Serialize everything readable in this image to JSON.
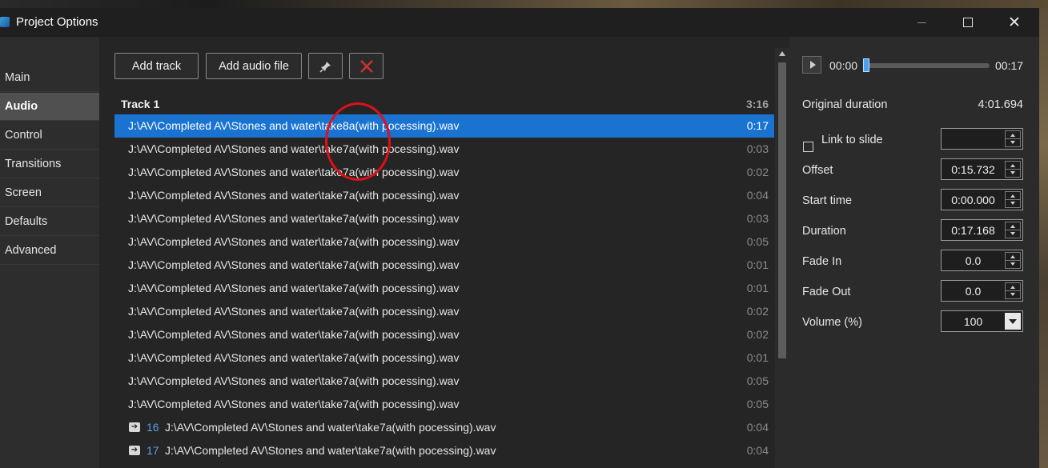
{
  "window": {
    "title": "Project Options",
    "controls": {
      "minimize": "—",
      "maximize": "☐",
      "close": "✕"
    }
  },
  "sidebar": {
    "items": [
      {
        "label": "Main",
        "active": false
      },
      {
        "label": "Audio",
        "active": true
      },
      {
        "label": "Control",
        "active": false
      },
      {
        "label": "Transitions",
        "active": false
      },
      {
        "label": "Screen",
        "active": false
      },
      {
        "label": "Defaults",
        "active": false
      },
      {
        "label": "Advanced",
        "active": false
      }
    ]
  },
  "toolbar": {
    "add_track_label": "Add track",
    "add_audio_file_label": "Add audio file",
    "edit_icon": "pin-icon",
    "delete_icon": "red-x-icon"
  },
  "track": {
    "name": "Track 1",
    "duration": "3:16",
    "files": [
      {
        "path": "J:\\AV\\Completed AV\\Stones and water\\take8a(with pocessing).wav",
        "time": "0:17",
        "selected": true
      },
      {
        "path": "J:\\AV\\Completed AV\\Stones and water\\take7a(with pocessing).wav",
        "time": "0:03"
      },
      {
        "path": "J:\\AV\\Completed AV\\Stones and water\\take7a(with pocessing).wav",
        "time": "0:02"
      },
      {
        "path": "J:\\AV\\Completed AV\\Stones and water\\take7a(with pocessing).wav",
        "time": "0:04"
      },
      {
        "path": "J:\\AV\\Completed AV\\Stones and water\\take7a(with pocessing).wav",
        "time": "0:03"
      },
      {
        "path": "J:\\AV\\Completed AV\\Stones and water\\take7a(with pocessing).wav",
        "time": "0:05"
      },
      {
        "path": "J:\\AV\\Completed AV\\Stones and water\\take7a(with pocessing).wav",
        "time": "0:01"
      },
      {
        "path": "J:\\AV\\Completed AV\\Stones and water\\take7a(with pocessing).wav",
        "time": "0:01"
      },
      {
        "path": "J:\\AV\\Completed AV\\Stones and water\\take7a(with pocessing).wav",
        "time": "0:02"
      },
      {
        "path": "J:\\AV\\Completed AV\\Stones and water\\take7a(with pocessing).wav",
        "time": "0:02"
      },
      {
        "path": "J:\\AV\\Completed AV\\Stones and water\\take7a(with pocessing).wav",
        "time": "0:01"
      },
      {
        "path": "J:\\AV\\Completed AV\\Stones and water\\take7a(with pocessing).wav",
        "time": "0:05"
      },
      {
        "path": "J:\\AV\\Completed AV\\Stones and water\\take7a(with pocessing).wav",
        "time": "0:05"
      },
      {
        "num": "16",
        "path": "J:\\AV\\Completed AV\\Stones and water\\take7a(with pocessing).wav",
        "time": "0:04",
        "linked": true
      },
      {
        "num": "17",
        "path": "J:\\AV\\Completed AV\\Stones and water\\take7a(with pocessing).wav",
        "time": "0:04",
        "linked": true
      }
    ]
  },
  "player": {
    "position": "00:00",
    "length": "00:17",
    "progress": 0
  },
  "properties": {
    "original_duration_label": "Original duration",
    "original_duration_value": "4:01.694",
    "link_to_slide_label": "Link to slide",
    "link_to_slide_checked": false,
    "link_to_slide_value": "",
    "offset_label": "Offset",
    "offset_value": "0:15.732",
    "start_time_label": "Start time",
    "start_time_value": "0:00.000",
    "duration_label": "Duration",
    "duration_value": "0:17.168",
    "fade_in_label": "Fade In",
    "fade_in_value": "0.0",
    "fade_out_label": "Fade Out",
    "fade_out_value": "0.0",
    "volume_label": "Volume (%)",
    "volume_value": "100"
  },
  "colors": {
    "selection": "#1a73d1",
    "annotation": "#e0101a",
    "delete": "#d03030"
  }
}
